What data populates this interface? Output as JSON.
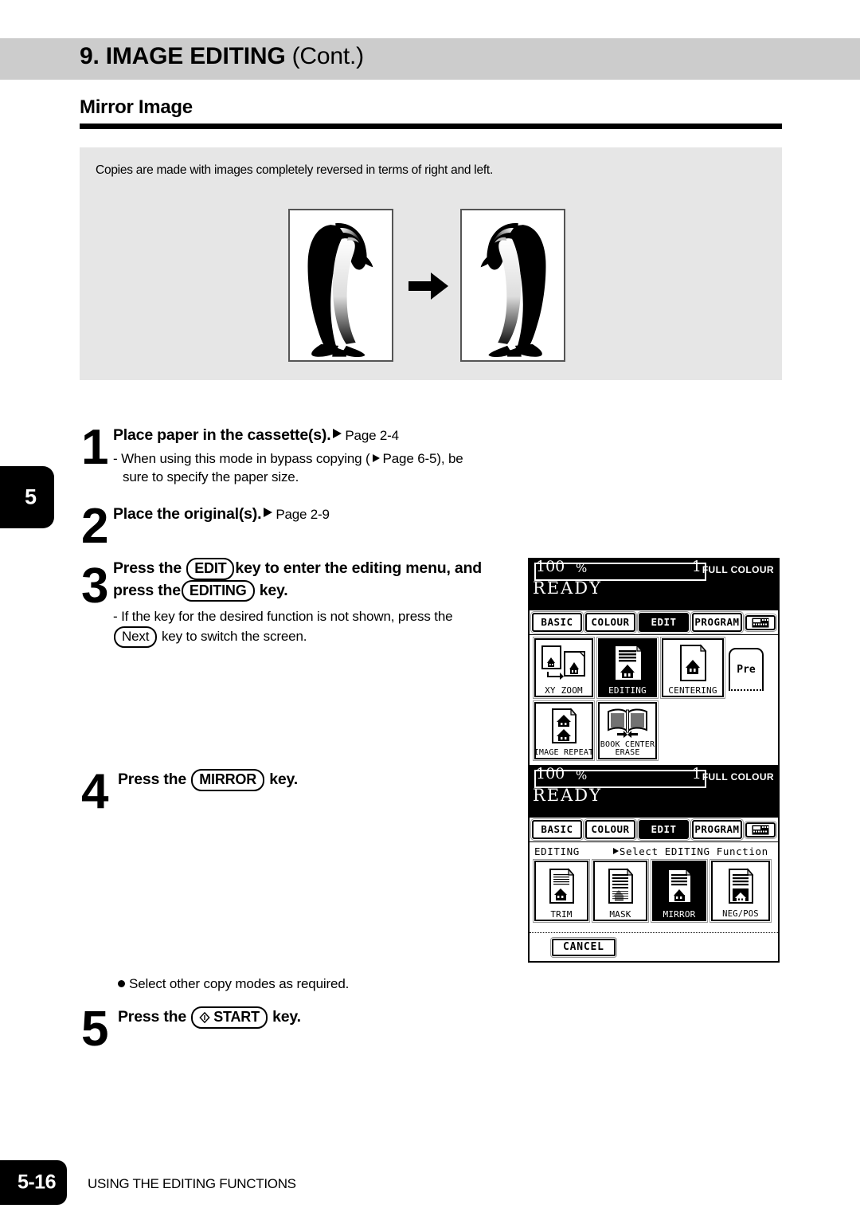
{
  "header": {
    "chapter_title": "9. IMAGE EDITING",
    "chapter_cont": " (Cont.)"
  },
  "section": {
    "title": "Mirror Image",
    "description": "Copies are made with images completely reversed in terms of right and left."
  },
  "chapter_tab": {
    "number": "5"
  },
  "steps": [
    {
      "number": "1",
      "heading": "Place paper in the cassette(s).",
      "page_ref": "Page 2-4",
      "sub_line1": "- When using this mode in bypass copying (",
      "sub_page_ref": "Page 6-5",
      "sub_line2": "), be",
      "sub_line3": "sure to specify the paper size."
    },
    {
      "number": "2",
      "heading": "Place the original(s).",
      "page_ref": "Page 2-9"
    },
    {
      "number": "3",
      "heading_pre": "Press the",
      "key1": "EDIT",
      "heading_mid": "key to enter the editing menu, and",
      "heading_line2_pre": "press the",
      "key2": "EDITING",
      "heading_line2_post": "key.",
      "sub_pre": "- If the key for the desired function is not shown, press the",
      "sub_key": "Next",
      "sub_post": "key to switch the screen."
    },
    {
      "number": "4",
      "heading_pre": "Press the",
      "key": "MIRROR",
      "heading_post": "key."
    },
    {
      "number": "5",
      "heading_pre": "Press the",
      "key": "START",
      "key_icon": "start-diamond-icon",
      "heading_post": "key."
    }
  ],
  "note": {
    "text": "Select other copy modes as required."
  },
  "lcd_panel_1": {
    "zoom": "100",
    "percent": "%",
    "count": "1",
    "colour_mode": "FULL COLOUR",
    "status": "READY",
    "tabs": [
      {
        "label": "BASIC",
        "active": false
      },
      {
        "label": "COLOUR",
        "active": false
      },
      {
        "label": "EDIT",
        "active": true
      },
      {
        "label": "PROGRAM",
        "active": false
      },
      {
        "label": "",
        "active": false,
        "icon": "keypad-icon"
      }
    ],
    "buttons": [
      {
        "label": "XY ZOOM",
        "selected": false,
        "icon": "xy-zoom-icon"
      },
      {
        "label": "EDITING",
        "selected": true,
        "icon": "editing-icon"
      },
      {
        "label": "CENTERING",
        "selected": false,
        "icon": "centering-icon"
      },
      {
        "label": "IMAGE REPEAT",
        "selected": false,
        "icon": "image-repeat-icon"
      },
      {
        "label": "BOOK CENTER ERASE",
        "selected": false,
        "icon": "book-center-erase-icon"
      }
    ],
    "partial_button": {
      "label": "Pre"
    }
  },
  "lcd_panel_2": {
    "zoom": "100",
    "percent": "%",
    "count": "1",
    "colour_mode": "FULL COLOUR",
    "status": "READY",
    "tabs": [
      {
        "label": "BASIC",
        "active": false
      },
      {
        "label": "COLOUR",
        "active": false
      },
      {
        "label": "EDIT",
        "active": true
      },
      {
        "label": "PROGRAM",
        "active": false
      },
      {
        "label": "",
        "active": false,
        "icon": "keypad-icon"
      }
    ],
    "mode_label": "EDITING",
    "prompt": "Select EDITING Function",
    "buttons": [
      {
        "label": "TRIM",
        "selected": false,
        "icon": "trim-icon"
      },
      {
        "label": "MASK",
        "selected": false,
        "icon": "mask-icon"
      },
      {
        "label": "MIRROR",
        "selected": true,
        "icon": "mirror-icon"
      },
      {
        "label": "NEG/POS",
        "selected": false,
        "icon": "neg-pos-icon"
      }
    ],
    "cancel_label": "CANCEL"
  },
  "footer": {
    "page_number": "5-16",
    "running_head": "USING THE EDITING FUNCTIONS"
  },
  "colors": {
    "header_band": "#cccccc",
    "illustration_panel": "#e6e6e6",
    "ink": "#000000"
  }
}
